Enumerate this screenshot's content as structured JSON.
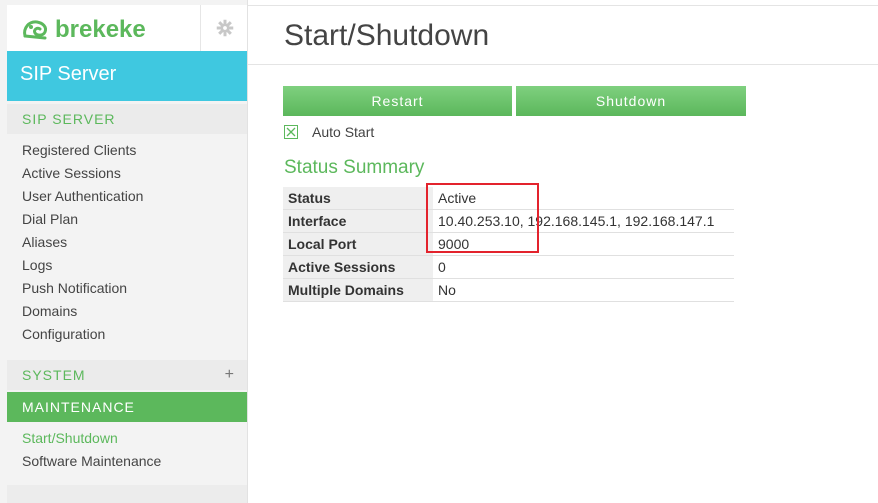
{
  "brand": {
    "name": "brekeke",
    "color": "#5cb85c",
    "icon": "frog-logo-icon"
  },
  "product": "SIP Server",
  "sidebar": {
    "sip_section": "SIP SERVER",
    "sip_items": [
      "Registered Clients",
      "Active Sessions",
      "User Authentication",
      "Dial Plan",
      "Aliases",
      "Logs",
      "Push Notification",
      "Domains",
      "Configuration"
    ],
    "system_section": "SYSTEM",
    "system_expand": "+",
    "maintenance_section": "MAINTENANCE",
    "maintenance_items": [
      "Start/Shutdown",
      "Software Maintenance"
    ],
    "active_item": "Start/Shutdown"
  },
  "page": {
    "title": "Start/Shutdown",
    "restart_label": "Restart",
    "shutdown_label": "Shutdown",
    "auto_start_label": "Auto Start",
    "auto_start_checked": true,
    "status_heading": "Status Summary"
  },
  "status_rows": [
    {
      "key": "Status",
      "value": "Active"
    },
    {
      "key": "Interface",
      "value": "10.40.253.10, 192.168.145.1, 192.168.147.1"
    },
    {
      "key": "Local Port",
      "value": "9000"
    },
    {
      "key": "Active Sessions",
      "value": "0"
    },
    {
      "key": "Multiple Domains",
      "value": "No"
    }
  ],
  "colors": {
    "accent_green": "#5cb85c",
    "product_bar": "#3fc8e0",
    "highlight": "#e3232d"
  }
}
